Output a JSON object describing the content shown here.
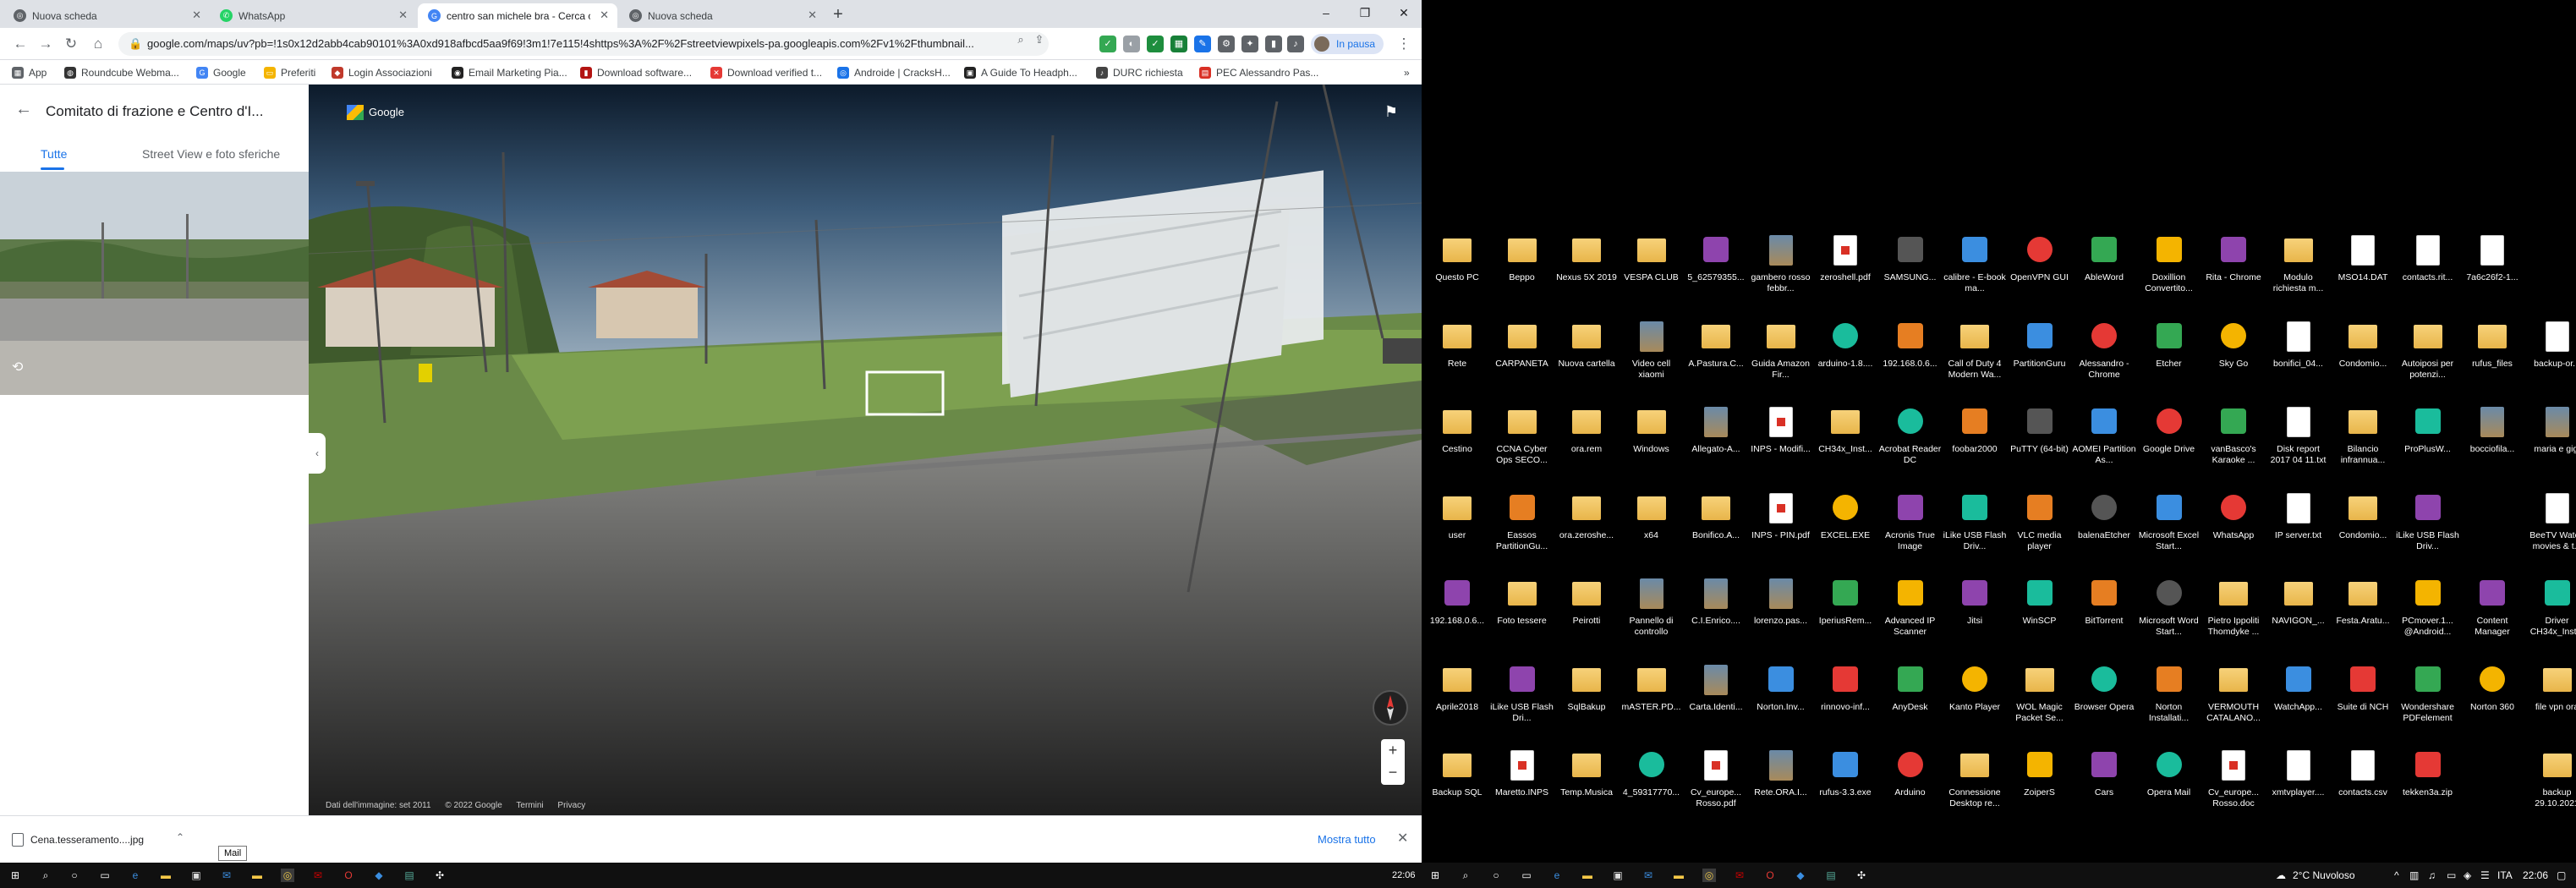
{
  "browser": {
    "tabs": [
      {
        "label": "Nuova scheda",
        "icon": "chrome-icon",
        "active": false
      },
      {
        "label": "WhatsApp",
        "icon": "whatsapp-icon",
        "active": false
      },
      {
        "label": "centro san michele bra - Cerca con Google",
        "icon": "chrome-icon",
        "active": true
      },
      {
        "label": "Nuova scheda",
        "icon": "chrome-icon",
        "active": false
      }
    ],
    "new_tab": "+",
    "window_controls": {
      "minimize": "–",
      "maximize": "❐",
      "close": "✕"
    },
    "url": "google.com/maps/uv?pb=!1s0x12d2abb4cab90101%3A0xd918afbcd5aa9f69!3m1!7e115!4shttps%3A%2F%2Fstreetviewpixels-pa.googleapis.com%2Fv1%2Fthumbnail...",
    "profile_status": "In pausa",
    "bookmarks": [
      {
        "label": "App",
        "color": "#5f6368"
      },
      {
        "label": "Roundcube Webma...",
        "color": "#333333"
      },
      {
        "label": "Google",
        "color": "#4285f4"
      },
      {
        "label": "Preferiti",
        "color": "#f4b400"
      },
      {
        "label": "Login Associazioni",
        "color": "#c0392b"
      },
      {
        "label": "Email Marketing Pia...",
        "color": "#222222"
      },
      {
        "label": "Download software...",
        "color": "#b31412"
      },
      {
        "label": "Download verified t...",
        "color": "#e53935"
      },
      {
        "label": "Androide | CracksH...",
        "color": "#1a73e8"
      },
      {
        "label": "A Guide To Headph...",
        "color": "#222222"
      },
      {
        "label": "DURC richiesta",
        "color": "#444444"
      },
      {
        "label": "PEC Alessandro Pas...",
        "color": "#d93025"
      }
    ]
  },
  "maps": {
    "panel_title": "Comitato di frazione e Centro d'I...",
    "tabs": [
      "Tutte",
      "Street View e foto sferiche"
    ],
    "viewer_brand": "Google",
    "footer": [
      "Dati dell'immagine: set 2011",
      "© 2022 Google",
      "Termini",
      "Privacy"
    ]
  },
  "downloads": {
    "file": "Cena.tesseramento....jpg",
    "show_all": "Mostra tutto",
    "tooltip": "Mail"
  },
  "taskbar_left": {
    "clock": "22:06"
  },
  "desktop": {
    "icons": [
      [
        "Questo PC",
        "Beppo",
        "Nexus 5X 2019",
        "VESPA CLUB",
        "5_62579355...",
        "gambero rosso febbr...",
        "zeroshell.pdf",
        "SAMSUNG...",
        "calibre - E-book ma...",
        "OpenVPN GUI",
        "AbleWord",
        "Doxillion Convertito...",
        "Rita - Chrome",
        "Modulo richiesta m...",
        "MSO14.DAT",
        "contacts.rit...",
        "7a6c26f2-1..."
      ],
      [
        "Rete",
        "CARPANETA",
        "Nuova cartella",
        "Video cell xiaomi",
        "A.Pastura.C...",
        "Guida Amazon Fir...",
        "arduino-1.8....",
        "192.168.0.6...",
        "Call of Duty 4 Modern Wa...",
        "PartitionGuru",
        "Alessandro - Chrome",
        "Etcher",
        "Sky Go",
        "bonifici_04...",
        "Condomio...",
        "Autoiposi per potenzi...",
        "rufus_files",
        "backup-or..."
      ],
      [
        "Cestino",
        "CCNA Cyber Ops SECO...",
        "ora.rem",
        "Windows",
        "Allegato-A...",
        "INPS - Modifi...",
        "CH34x_Inst...",
        "Acrobat Reader DC",
        "foobar2000",
        "PuTTY (64-bit)",
        "AOMEI Partition As...",
        "Google Drive",
        "vanBasco's Karaoke ...",
        "Disk report 2017 04 11.txt",
        "Bilancio infrannua...",
        "ProPlusW...",
        "bocciofila...",
        "maria e gigi"
      ],
      [
        "user",
        "Eassos PartitionGu...",
        "ora.zeroshe...",
        "x64",
        "Bonifico.A...",
        "INPS - PIN.pdf",
        "EXCEL.EXE",
        "Acronis True Image",
        "iLike USB Flash Driv...",
        "VLC media player",
        "balenaEtcher",
        "Microsoft Excel Start...",
        "WhatsApp",
        "IP server.txt",
        "Condomio...",
        "iLike USB Flash Driv...",
        "",
        "BeeTV Watch movies & t..."
      ],
      [
        "192.168.0.6...",
        "Foto tessere",
        "Peirotti",
        "Pannello di controllo",
        "C.I.Enrico....",
        "lorenzo.pas...",
        "IperiusRem...",
        "Advanced IP Scanner",
        "Jitsi",
        "WinSCP",
        "BitTorrent",
        "Microsoft Word Start...",
        "Pietro Ippoliti Thomdyke ...",
        "NAVIGON_...",
        "Festa.Aratu...",
        "PCmover.1... @Android...",
        "Content Manager",
        "Driver CH34x_Inst..."
      ],
      [
        "Aprile2018",
        "iLike USB Flash Dri...",
        "SqlBakup",
        "mASTER.PD...",
        "Carta.Identi...",
        "Norton.Inv...",
        "rinnovo-inf...",
        "AnyDesk",
        "Kanto Player",
        "WOL Magic Packet Se...",
        "Browser Opera",
        "Norton Installati...",
        "VERMOUTH CATALANO...",
        "WatchApp...",
        "Suite di NCH",
        "Wondershare PDFelement",
        "Norton 360",
        "file vpn ora"
      ],
      [
        "Backup SQL",
        "Maretto.INPS",
        "Temp.Musica",
        "4_59317770...",
        "Cv_europe... Rosso.pdf",
        "Rete.ORA.I...",
        "rufus-3.3.exe",
        "Arduino",
        "Connessione Desktop re...",
        "ZoiperS",
        "Cars",
        "Opera Mail",
        "Cv_europe... Rosso.doc",
        "xmtvplayer....",
        "contacts.csv",
        "tekken3a.zip",
        "",
        "backup 29.10.2021"
      ]
    ]
  },
  "taskbar_right": {
    "weather": "2°C Nuvoloso",
    "lang": "ITA",
    "clock": "22:06"
  }
}
